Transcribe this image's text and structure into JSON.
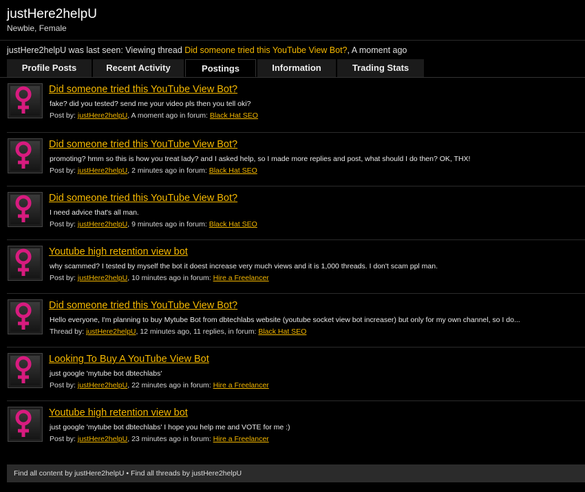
{
  "profile": {
    "username": "justHere2helpU",
    "user_title": "Newbie, Female"
  },
  "last_seen": {
    "prefix": "justHere2helpU was last seen: Viewing thread ",
    "thread_link": "Did someone tried this YouTube View Bot?",
    "suffix": ", A moment ago"
  },
  "tabs": [
    {
      "label": "Profile Posts"
    },
    {
      "label": "Recent Activity"
    },
    {
      "label": "Postings"
    },
    {
      "label": "Information"
    },
    {
      "label": "Trading Stats"
    }
  ],
  "posts": [
    {
      "title": "Did someone tried this YouTube View Bot?",
      "snippet": "fake? did you tested? send me your video pls then you tell oki?",
      "prefix": "Post by: ",
      "author": "justHere2helpU",
      "middle": ", A moment ago in forum: ",
      "forum": "Black Hat SEO"
    },
    {
      "title": "Did someone tried this YouTube View Bot?",
      "snippet": "promoting? hmm so this is how you treat lady? and I asked help, so I made more replies and post, what should I do then? OK, THX!",
      "prefix": "Post by: ",
      "author": "justHere2helpU",
      "middle": ", 2 minutes ago in forum: ",
      "forum": "Black Hat SEO"
    },
    {
      "title": "Did someone tried this YouTube View Bot?",
      "snippet": "I need advice that's all man.",
      "prefix": "Post by: ",
      "author": "justHere2helpU",
      "middle": ", 9 minutes ago in forum: ",
      "forum": "Black Hat SEO"
    },
    {
      "title": "Youtube high retention view bot",
      "snippet": "why scammed? I tested by myself the bot it doest increase very much views and it is 1,000 threads. I don't scam ppl man.",
      "prefix": "Post by: ",
      "author": "justHere2helpU",
      "middle": ", 10 minutes ago in forum: ",
      "forum": "Hire a Freelancer"
    },
    {
      "title": "Did someone tried this YouTube View Bot?",
      "snippet": "Hello everyone, I'm planning to buy Mytube Bot from dbtechlabs website (youtube socket view bot increaser) but only for my own channel, so I do...",
      "prefix": "Thread by: ",
      "author": "justHere2helpU",
      "middle": ", 12 minutes ago, 11 replies, in forum: ",
      "forum": "Black Hat SEO"
    },
    {
      "title": "Looking To Buy A YouTube View Bot",
      "snippet": "just google 'mytube bot dbtechlabs'",
      "prefix": "Post by: ",
      "author": "justHere2helpU",
      "middle": ", 22 minutes ago in forum: ",
      "forum": "Hire a Freelancer"
    },
    {
      "title": "Youtube high retention view bot",
      "snippet": "just google 'mytube bot dbtechlabs' I hope you help me and VOTE for me :)",
      "prefix": "Post by: ",
      "author": "justHere2helpU",
      "middle": ", 23 minutes ago in forum: ",
      "forum": "Hire a Freelancer"
    }
  ],
  "footer": {
    "find_content": "Find all content by justHere2helpU",
    "separator": " • ",
    "find_threads": "Find all threads by justHere2helpU"
  },
  "colors": {
    "background": "#000000",
    "link": "#f5b800",
    "avatar_symbol": "#d81b7f"
  },
  "icons": {
    "avatar": "female-symbol-icon"
  }
}
